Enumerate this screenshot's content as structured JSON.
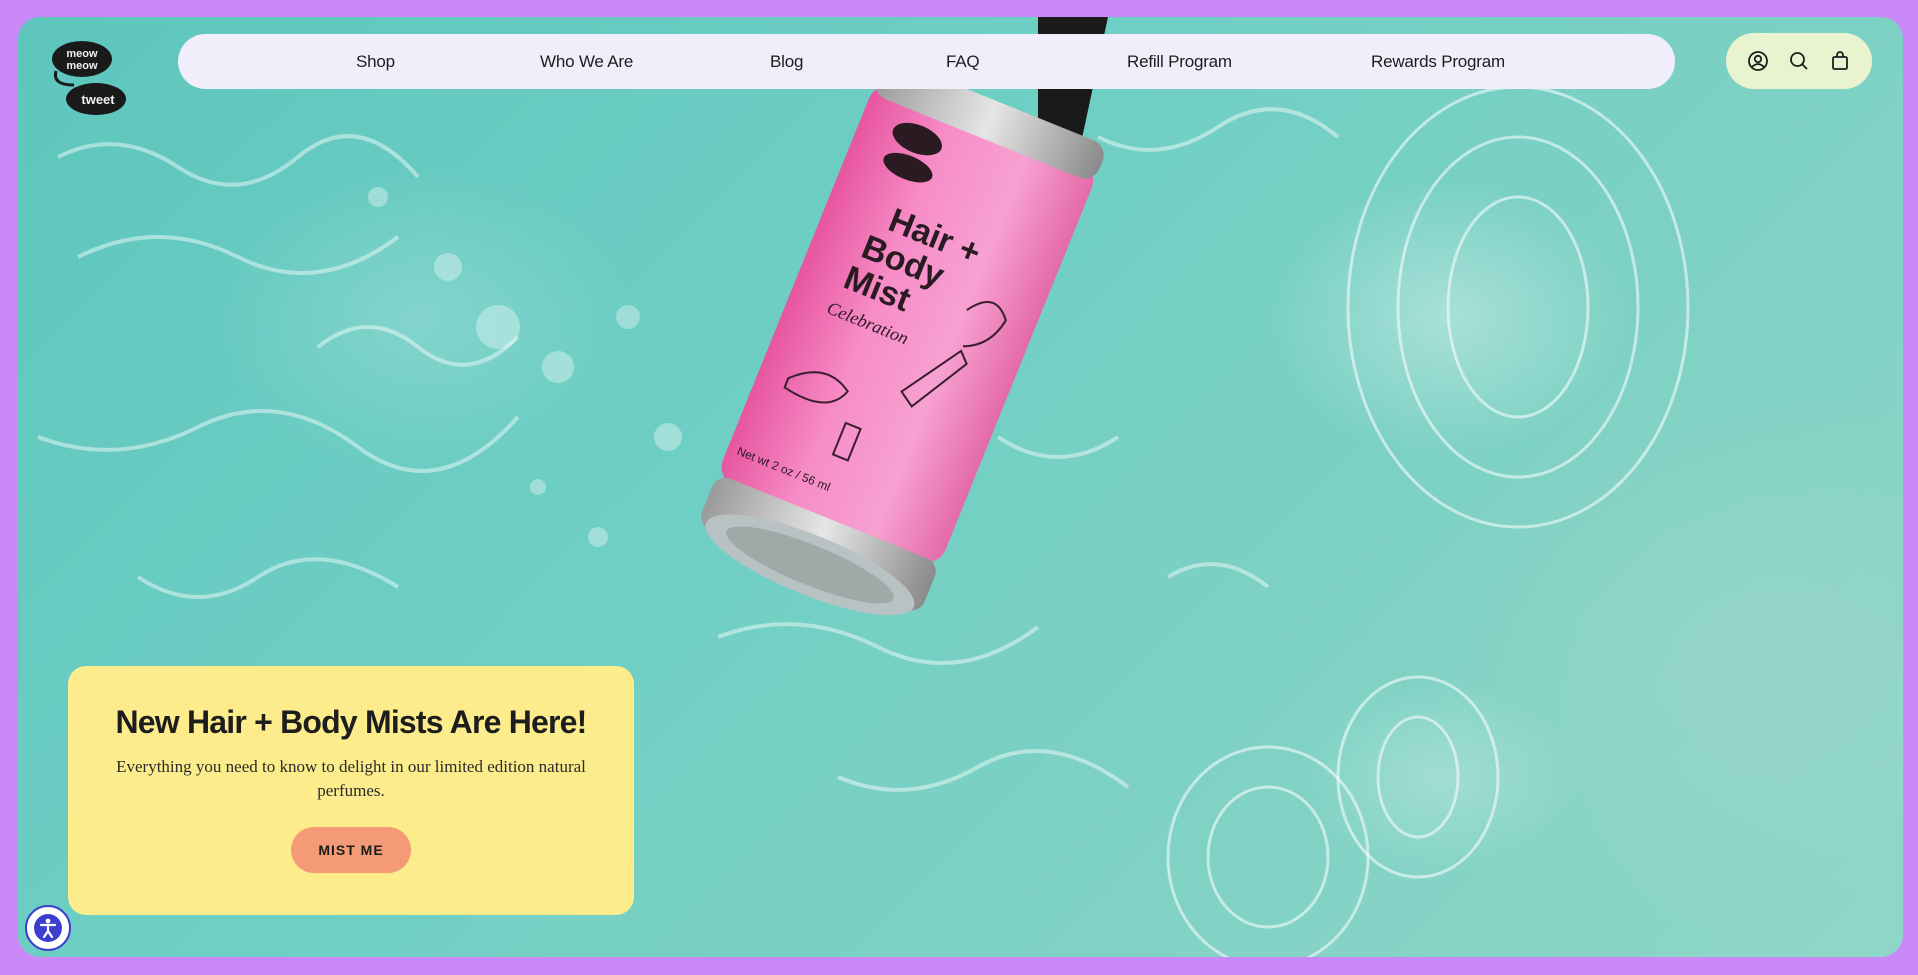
{
  "brand": {
    "logo_line1": "meow",
    "logo_line2": "meow",
    "logo_line3": "tweet"
  },
  "nav": {
    "items": [
      {
        "label": "Shop"
      },
      {
        "label": "Who We Are"
      },
      {
        "label": "Blog"
      },
      {
        "label": "FAQ"
      },
      {
        "label": "Refill Program"
      },
      {
        "label": "Rewards Program"
      }
    ]
  },
  "header_icons": [
    "account-icon",
    "search-icon",
    "cart-icon"
  ],
  "hero": {
    "product": {
      "title_line1": "Hair +",
      "title_line2": "Body",
      "title_line3": "Mist",
      "subtitle": "Celebration",
      "net_wt": "Net wt 2 oz / 56 ml"
    }
  },
  "promo": {
    "heading": "New Hair + Body Mists Are Here!",
    "body": "Everything you need to know to delight in our limited edition natural perfumes.",
    "cta_label": "MIST ME"
  },
  "colors": {
    "page_border": "#c98af7",
    "nav_bg": "#efeefa",
    "icons_bg": "#e9f3cf",
    "promo_bg": "#fcec8c",
    "cta_bg": "#f49a76",
    "water": "#6fcfc4",
    "bottle_pink": "#f58bc4"
  },
  "accessibility": {
    "icon": "accessibility-icon"
  }
}
